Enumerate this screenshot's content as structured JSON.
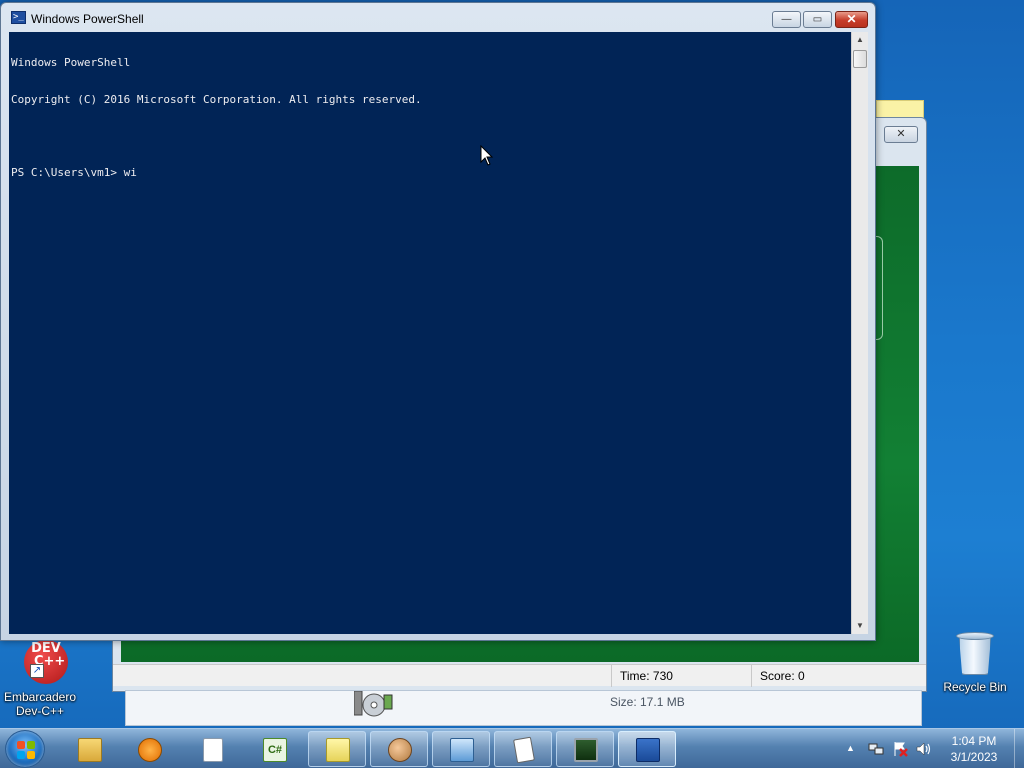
{
  "desktop": {
    "icons": [
      {
        "label_line1": "Embarcadero",
        "label_line2": "Dev-C++",
        "logo_text_top": "DEV",
        "logo_text_bottom": "C++"
      },
      {
        "label": "Recycle Bin"
      }
    ]
  },
  "background_window": {
    "close_glyph": "✕",
    "status": {
      "time": "Time:  730",
      "score": "Score: 0"
    }
  },
  "explorer_strip": {
    "size_text": "Size: 17.1 MB"
  },
  "powershell": {
    "title": "Windows PowerShell",
    "icon_glyph": ">_",
    "buttons": {
      "minimize": "—",
      "maximize": "▭",
      "close": "✕"
    },
    "console_lines": [
      "Windows PowerShell",
      "Copyright (C) 2016 Microsoft Corporation. All rights reserved.",
      "",
      "PS C:\\Users\\vm1> wi"
    ],
    "background_color": "#012456",
    "text_color": "#EEEDF0"
  },
  "taskbar": {
    "items": [
      {
        "icon": "windows-explorer-icon"
      },
      {
        "icon": "media-player-icon"
      },
      {
        "icon": "blank-document-icon"
      },
      {
        "icon": "csharp-project-icon",
        "glyph": "C#"
      },
      {
        "icon": "sticky-notes-icon"
      },
      {
        "icon": "users-icon"
      },
      {
        "icon": "control-panel-icon"
      },
      {
        "icon": "solitaire-icon"
      },
      {
        "icon": "resource-monitor-icon"
      },
      {
        "icon": "powershell-icon"
      }
    ],
    "tray": {
      "icons": [
        "network-icon",
        "action-center-icon",
        "volume-icon"
      ]
    },
    "clock": {
      "time": "1:04 PM",
      "date": "3/1/2023"
    }
  }
}
